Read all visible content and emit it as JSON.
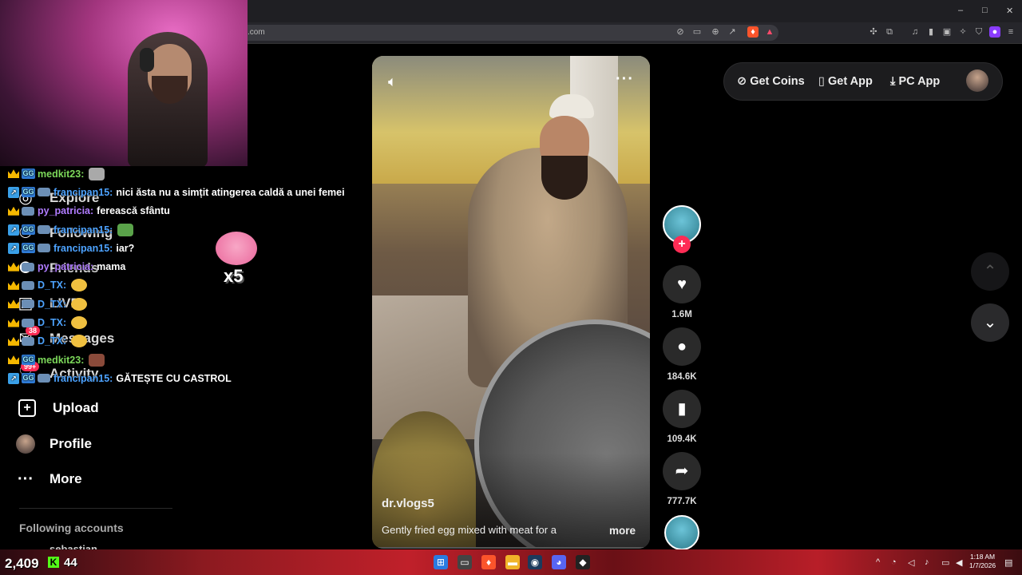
{
  "browser": {
    "url_fragment": ".com",
    "window_controls": {
      "minimize": "–",
      "maximize": "□",
      "close": "✕"
    }
  },
  "sidebar": {
    "items": [
      {
        "label": "Explore",
        "icon": "compass-icon"
      },
      {
        "label": "Following",
        "icon": "following-icon"
      },
      {
        "label": "Friends",
        "icon": "friends-icon"
      },
      {
        "label": "LIVE",
        "icon": "live-icon"
      },
      {
        "label": "Messages",
        "icon": "messages-icon",
        "badge": "38"
      },
      {
        "label": "Activity",
        "icon": "activity-icon",
        "badge": "99+"
      },
      {
        "label": "Upload",
        "icon": "upload-icon"
      },
      {
        "label": "Profile",
        "icon": "profile-avatar"
      },
      {
        "label": "More",
        "icon": "more-icon"
      }
    ],
    "following_accounts_title": "Following accounts",
    "following_account_1": "sebastian"
  },
  "chat": {
    "messages": [
      {
        "user": "medkit23:",
        "user_color": "#7cd85a",
        "text": ""
      },
      {
        "user": "francipan15:",
        "user_color": "#4da3ff",
        "text": "nici ăsta nu a simțit atingerea caldă a unei femei"
      },
      {
        "user": "py_patricia:",
        "user_color": "#b07cff",
        "text": "ferească sfântu"
      },
      {
        "user": "francipan15:",
        "user_color": "#4da3ff",
        "text": ""
      },
      {
        "user": "francipan15:",
        "user_color": "#4da3ff",
        "text": "iar?"
      },
      {
        "user": "py_patricia:",
        "user_color": "#b07cff",
        "text": "mama"
      },
      {
        "user": "D_TX:",
        "user_color": "#4da3ff",
        "text": ""
      },
      {
        "user": "D_TX:",
        "user_color": "#4da3ff",
        "text": ""
      },
      {
        "user": "D_TX:",
        "user_color": "#4da3ff",
        "text": ""
      },
      {
        "user": "D_TX:",
        "user_color": "#4da3ff",
        "text": ""
      },
      {
        "user": "medkit23:",
        "user_color": "#7cd85a",
        "text": ""
      },
      {
        "user": "francipan15:",
        "user_color": "#4da3ff",
        "text": "GĂTEȘTE CU CASTROL"
      }
    ],
    "kirby_multiplier": "x5"
  },
  "video": {
    "author": "dr.vlogs5",
    "description": "Gently fried egg mixed with meat for a",
    "more_label": "more",
    "more_options": "···"
  },
  "actions": {
    "likes": "1.6M",
    "comments": "184.6K",
    "saves": "109.4K",
    "shares": "777.7K"
  },
  "header": {
    "get_coins": "Get Coins",
    "get_app": "Get App",
    "pc_app": "PC App"
  },
  "stream_stats": {
    "viewers": "2,409",
    "kick_count": "44"
  },
  "taskbar": {
    "time": "1:18 AM",
    "date": "1/7/2026"
  },
  "colors": {
    "accent": "#fe2c55",
    "background": "#000000",
    "kick_green": "#53fc18"
  }
}
